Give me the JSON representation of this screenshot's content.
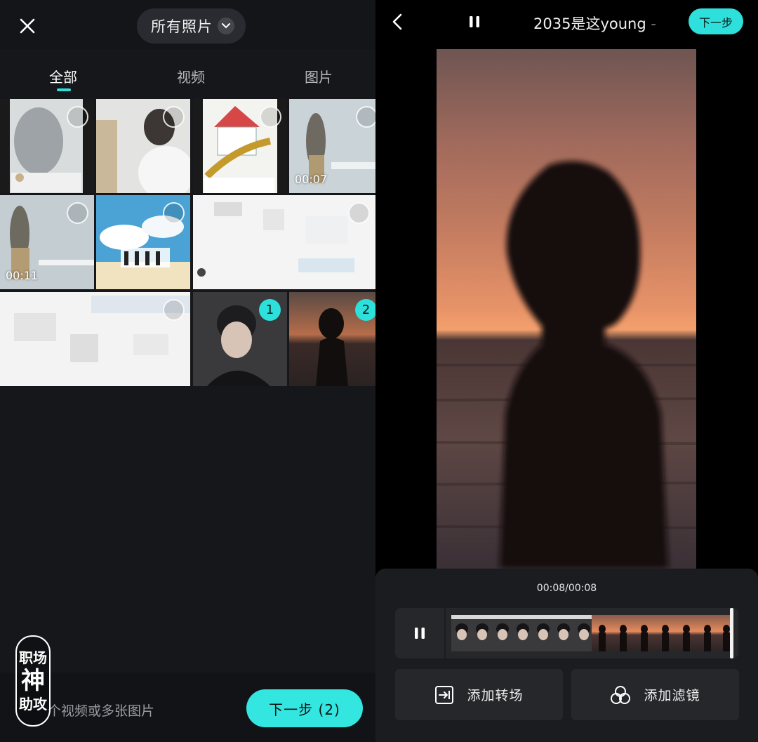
{
  "left": {
    "header": {
      "album_label": "所有照片"
    },
    "tabs": [
      {
        "label": "全部",
        "active": true
      },
      {
        "label": "视频",
        "active": false
      },
      {
        "label": "图片",
        "active": false
      }
    ],
    "grid": {
      "durations": [
        "00:07",
        "00:11"
      ],
      "selection_numbers": [
        "1",
        "2"
      ]
    },
    "footer": {
      "hint": "个视频或多张图片",
      "next_button": "下一步 (2)"
    },
    "watermark": [
      "职场",
      "神",
      "助攻"
    ]
  },
  "right": {
    "header": {
      "title": "2035是这young",
      "title_fade": " -",
      "next_button": "下一步"
    },
    "timeline": {
      "time_readout": "00:08/00:08"
    },
    "actions": [
      {
        "label": "添加转场",
        "icon": "transition-icon"
      },
      {
        "label": "添加滤镜",
        "icon": "filter-icon"
      }
    ]
  },
  "colors": {
    "accent": "#2de0db",
    "bg_dark": "#16171b",
    "panel": "#1b1c20"
  }
}
